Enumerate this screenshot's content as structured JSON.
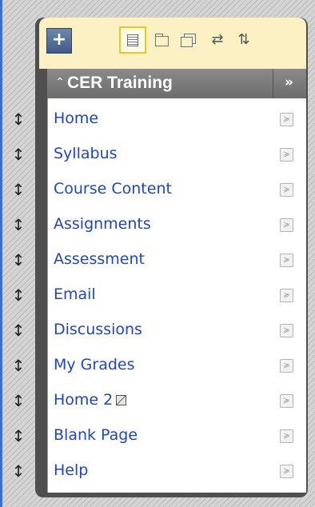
{
  "toolbar": {
    "add_icon": "plus-icon",
    "tools": [
      {
        "name": "list-view-icon"
      },
      {
        "name": "folder-view-icon"
      },
      {
        "name": "windows-icon"
      },
      {
        "name": "refresh-icon"
      },
      {
        "name": "sort-icon"
      }
    ],
    "accent": "#f3c328",
    "background": "#fbf1c3"
  },
  "course": {
    "title": "CER Training",
    "collapse_glyph": "≈",
    "expand_glyph": "»"
  },
  "menu": {
    "items": [
      {
        "label": "Home"
      },
      {
        "label": "Syllabus"
      },
      {
        "label": "Course Content"
      },
      {
        "label": "Assignments"
      },
      {
        "label": "Assessment"
      },
      {
        "label": "Email"
      },
      {
        "label": "Discussions"
      },
      {
        "label": "My Grades"
      },
      {
        "label": "Home 2"
      },
      {
        "label": "Blank Page"
      },
      {
        "label": "Help"
      }
    ],
    "link_color": "#1d45c8"
  }
}
